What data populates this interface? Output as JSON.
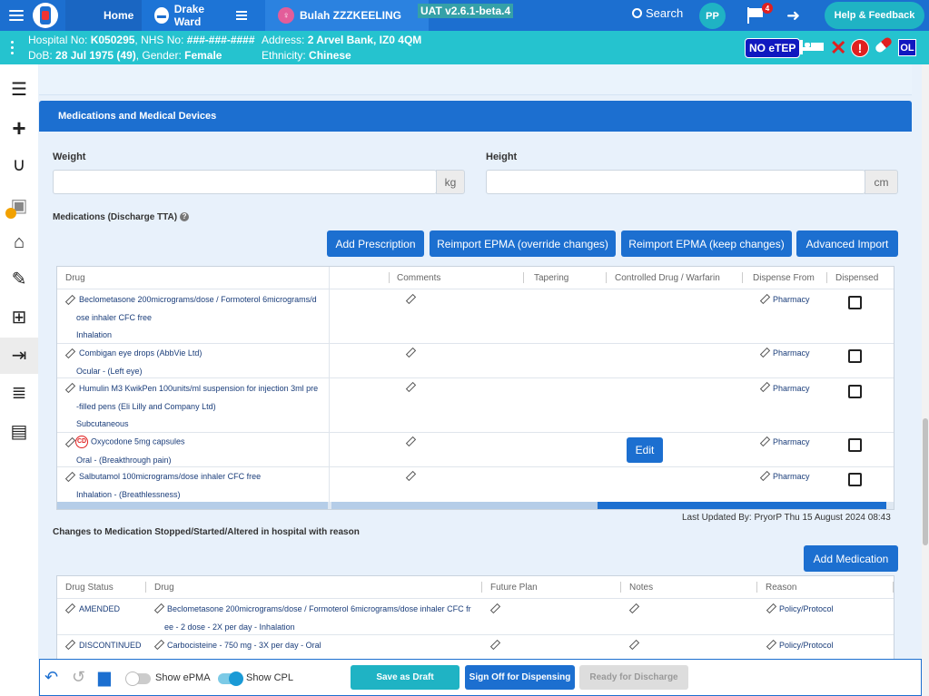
{
  "topnav": {
    "home": "Home",
    "ward": "Drake Ward",
    "patient": "Bulah ZZZKEELING",
    "version": "UAT v2.6.1-beta.4",
    "search": "Search",
    "user_initials": "PP",
    "flag_count": "4",
    "help": "Help & Feedback"
  },
  "patient": {
    "hospital_label": "Hospital No: ",
    "hospital_no": "K050295",
    "nhs_label": ", NHS No: ",
    "nhs_no": "###-###-####",
    "dob_label": "DoB: ",
    "dob": "28 Jul 1975 (49)",
    "gender_label": ", Gender: ",
    "gender": "Female",
    "address_label": "Address: ",
    "address": "2 Arvel Bank, IZ0 4QM",
    "ethnicity_label": "Ethnicity: ",
    "ethnicity": "Chinese",
    "etep_badge": "NO eTEP",
    "ol_badge": "OL"
  },
  "section": {
    "title": "Medications and Medical Devices",
    "weight_label": "Weight",
    "weight_unit": "kg",
    "height_label": "Height",
    "height_unit": "cm",
    "tta_label": "Medications (Discharge TTA)",
    "buttons": {
      "add_prescription": "Add Prescription",
      "reimport_override": "Reimport EPMA (override changes)",
      "reimport_keep": "Reimport EPMA (keep changes)",
      "advanced_import": "Advanced Import"
    }
  },
  "tta_table": {
    "headers": {
      "drug": "Drug",
      "comments": "Comments",
      "tapering": "Tapering",
      "controlled": "Controlled Drug / Warfarin",
      "dispense_from": "Dispense From",
      "dispensed": "Dispensed"
    },
    "rows": [
      {
        "line1": "Beclometasone 200micrograms/dose / Formoterol 6micrograms/d",
        "line2": "ose inhaler CFC free",
        "line3": "Inhalation",
        "dispense": "Pharmacy"
      },
      {
        "line1": "Combigan eye drops (AbbVie Ltd)",
        "line2": "Ocular - (Left eye)",
        "line3": "",
        "dispense": "Pharmacy"
      },
      {
        "line1": "Humulin M3 KwikPen 100units/ml suspension for injection 3ml pre",
        "line2": "-filled pens (Eli Lilly and Company Ltd)",
        "line3": "Subcutaneous",
        "dispense": "Pharmacy"
      },
      {
        "line1": "Oxycodone 5mg capsules",
        "line2": "Oral - (Breakthrough pain)",
        "line3": "",
        "dispense": "Pharmacy",
        "cd": "CD",
        "edit": "Edit"
      },
      {
        "line1": "Salbutamol 100micrograms/dose inhaler CFC free",
        "line2": "Inhalation - (Breathlessness)",
        "line3": "",
        "dispense": "Pharmacy"
      }
    ]
  },
  "last_updated": "Last Updated By: PryorP Thu 15 August 2024 08:43",
  "changes": {
    "title": "Changes to Medication Stopped/Started/Altered in hospital with reason",
    "add_button": "Add Medication",
    "headers": {
      "status": "Drug Status",
      "drug": "Drug",
      "future_plan": "Future Plan",
      "notes": "Notes",
      "reason": "Reason"
    },
    "rows": [
      {
        "status": "AMENDED",
        "drug1": "Beclometasone 200micrograms/dose / Formoterol 6micrograms/dose inhaler CFC fr",
        "drug2": "ee - 2 dose - 2X per day - Inhalation",
        "reason": "Policy/Protocol"
      },
      {
        "status": "DISCONTINUED",
        "drug1": "Carbocisteine - 750 mg - 3X per day - Oral",
        "drug2": "",
        "reason": "Policy/Protocol"
      }
    ]
  },
  "footer": {
    "show_epma": "Show ePMA",
    "show_cpl": "Show CPL",
    "save_draft": "Save as Draft",
    "sign_off": "Sign Off for Dispensing",
    "ready_discharge": "Ready for Discharge"
  },
  "colors": {
    "primary": "#1c6fd0",
    "banner": "#25c3cf",
    "teal_button": "#1fb3c4",
    "alert_red": "#e02020"
  }
}
